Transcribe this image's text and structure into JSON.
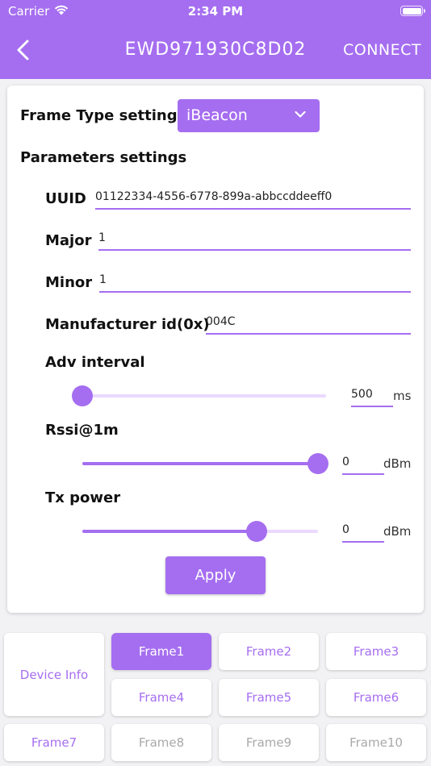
{
  "status_bar": {
    "carrier": "Carrier",
    "time": "2:34 PM"
  },
  "appbar": {
    "title": "EWD971930C8D02",
    "connect_label": "CONNECT"
  },
  "colors": {
    "accent": "#a56ef0",
    "track_inactive": "#ead9fd",
    "disabled_text": "#a9a9a9"
  },
  "form": {
    "frame_type_label": "Frame Type setting",
    "frame_type_value": "iBeacon",
    "params_label": "Parameters settings",
    "uuid": {
      "label": "UUID",
      "value": "01122334-4556-6778-899a-abbccddeeff0"
    },
    "major": {
      "label": "Major",
      "value": "1"
    },
    "minor": {
      "label": "Minor",
      "value": "1"
    },
    "manufacturer": {
      "label": "Manufacturer id(0x)",
      "value": "004C"
    },
    "adv_interval": {
      "label": "Adv interval",
      "value": "500",
      "unit": "ms",
      "slider_fraction": 0.0
    },
    "rssi": {
      "label": "Rssi@1m",
      "value": "0",
      "unit": "dBm",
      "slider_fraction": 1.0
    },
    "tx_power": {
      "label": "Tx power",
      "value": "0",
      "unit": "dBm",
      "slider_fraction": 0.74
    },
    "apply_label": "Apply"
  },
  "tiles": {
    "device_info": "Device Info",
    "frame1": "Frame1",
    "frame2": "Frame2",
    "frame3": "Frame3",
    "frame4": "Frame4",
    "frame5": "Frame5",
    "frame6": "Frame6",
    "frame7": "Frame7",
    "frame8": "Frame8",
    "frame9": "Frame9",
    "frame10": "Frame10"
  }
}
